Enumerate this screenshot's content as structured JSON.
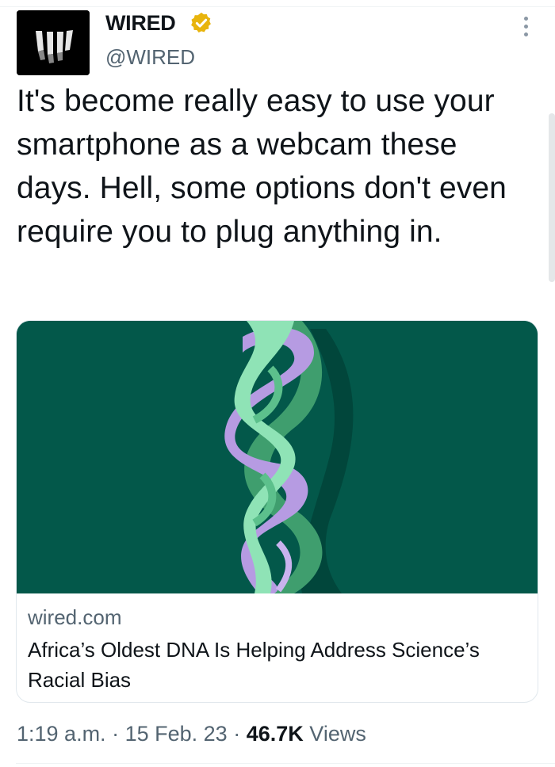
{
  "author": {
    "name": "WIRED",
    "handle": "@WIRED",
    "verified": true,
    "verified_color": "#e8b40c"
  },
  "tweet": {
    "text": "It's become really easy to use your smartphone as a webcam these days. Hell, some options don't even require you to plug anything in."
  },
  "card": {
    "domain": "wired.com",
    "title": "Africa’s Oldest DNA Is Helping Address Science’s Racial Bias",
    "image_background": "#03584a",
    "image_icon": "dna-helix-image"
  },
  "meta": {
    "time": "1:19 a.m.",
    "separator": "·",
    "date": "15 Feb. 23",
    "views_count": "46.7K",
    "views_label": "Views"
  },
  "icons": {
    "more": "more-vertical-icon",
    "verified": "verified-badge-icon"
  }
}
